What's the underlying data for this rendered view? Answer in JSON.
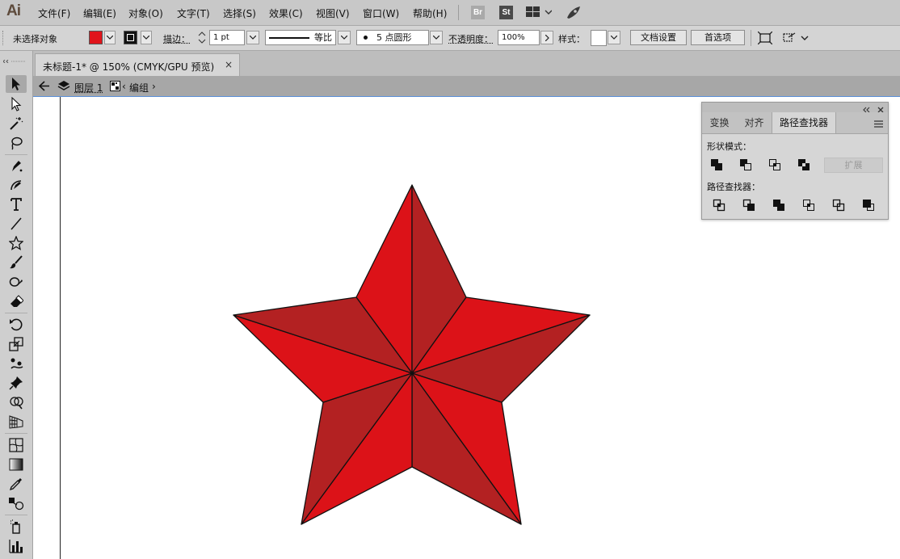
{
  "app": {
    "logo": "Ai"
  },
  "menu": [
    "文件(F)",
    "编辑(E)",
    "对象(O)",
    "文字(T)",
    "选择(S)",
    "效果(C)",
    "视图(V)",
    "窗口(W)",
    "帮助(H)"
  ],
  "menubar_icons": {
    "bridge": "Br",
    "stock": "St",
    "workspace": "workspace-grid-icon",
    "publish": "rocket-icon"
  },
  "control": {
    "selection_label": "未选择对象",
    "fill_color": "#e0141b",
    "stroke_label": "描边：",
    "stroke_weight": "1 pt",
    "stroke_profile": "等比",
    "brush_label": "5 点圆形",
    "opacity_label": "不透明度：",
    "opacity_value": "100%",
    "style_label": "样式：",
    "doc_setup": "文档设置",
    "preferences": "首选项"
  },
  "document": {
    "tab_title": "未标题-1* @ 150% (CMYK/GPU 预览)",
    "close": "×",
    "breadcrumb_layer": "图层 1",
    "breadcrumb_group": "编组"
  },
  "star": {
    "bright_red": "#dc1218",
    "dark_red": "#b32122",
    "outline": "#111111"
  },
  "panel": {
    "tabs": [
      "变换",
      "对齐",
      "路径查找器"
    ],
    "active_tab": "路径查找器",
    "shape_modes_label": "形状模式：",
    "expand_label": "扩展",
    "pathfinders_label": "路径查找器："
  }
}
